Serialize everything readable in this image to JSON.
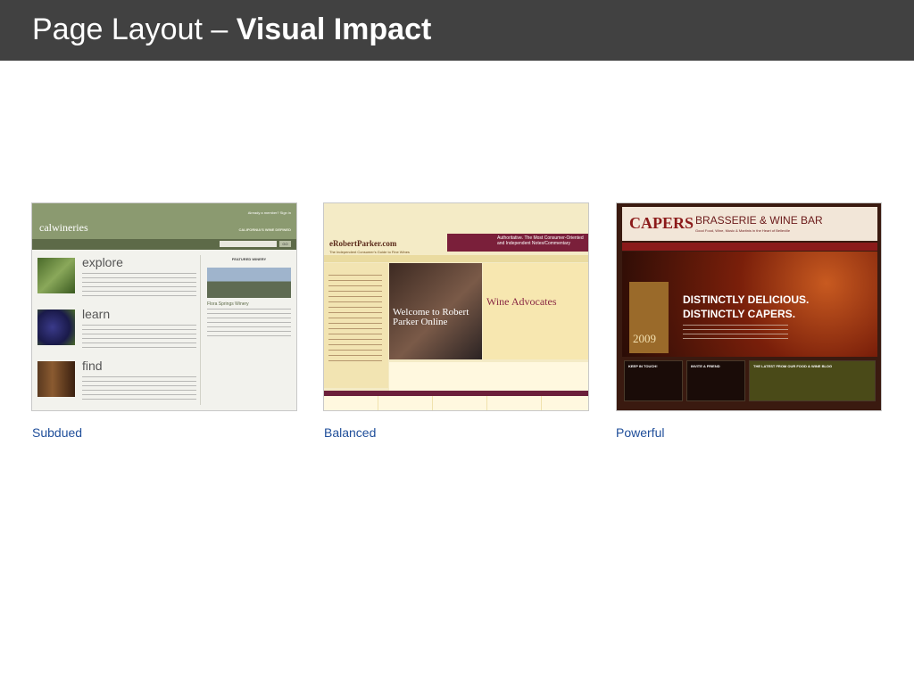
{
  "header": {
    "title_plain": "Page Layout – ",
    "title_bold": "Visual Impact"
  },
  "thumbnails": [
    {
      "caption": "Subdued",
      "logo": "calwineries",
      "tagline": "CALIFORNIA'S WINE DEFINED",
      "signin": "Already a member? Sign in",
      "search_label": "Search",
      "go_label": "GO",
      "sections": [
        "explore",
        "learn",
        "find"
      ],
      "featured_label": "FEATURED WINERY",
      "featured_title": "Flora Springs Winery"
    },
    {
      "caption": "Balanced",
      "logo": "eRobertParker.com",
      "subtitle": "The Independent Consumer's Guide to Fine Wines",
      "banner": "Authoritative. The Most Consumer-Oriented and Independent Notes/Commentary",
      "photo_text": "Welcome to Robert Parker Online",
      "headline": "Wine Advocates",
      "left_heading": "What's Inside"
    },
    {
      "caption": "Powerful",
      "brand": "CAPERS",
      "tagline": "BRASSERIE & WINE BAR",
      "sub_tagline": "Good Food, Wine, Music & Martinis in the Heart of Belleville",
      "hero_line1": "DISTINCTLY DELICIOUS.",
      "hero_line2": "DISTINCTLY CAPERS.",
      "award_year": "2009",
      "box1": "KEEP IN TOUCH!",
      "box2": "INVITE A FRIEND",
      "box3": "THE LATEST FROM OUR FOOD & WINE BLOG"
    }
  ]
}
